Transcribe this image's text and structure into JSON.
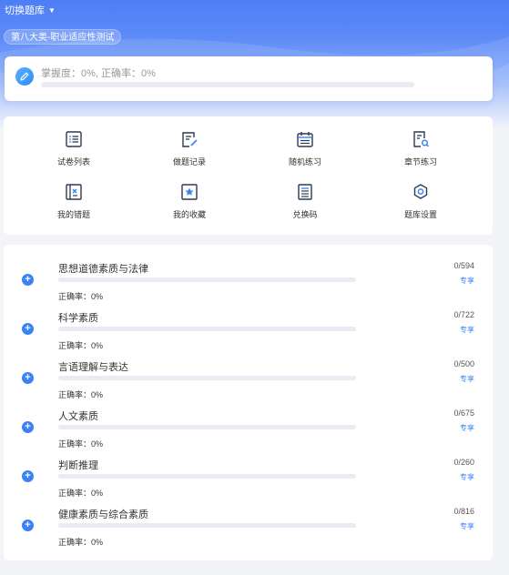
{
  "header": {
    "switch_label": "切换题库",
    "bank_name": "第八大类-职业适应性测试"
  },
  "progress": {
    "text": "掌握度：0%, 正确率：0%",
    "mastery_fraction": 0
  },
  "menu": [
    {
      "label": "试卷列表",
      "icon": "list-icon"
    },
    {
      "label": "做题记录",
      "icon": "edit-record-icon"
    },
    {
      "label": "随机练习",
      "icon": "calendar-icon"
    },
    {
      "label": "章节练习",
      "icon": "document-search-icon"
    },
    {
      "label": "我的错题",
      "icon": "wrong-book-icon"
    },
    {
      "label": "我的收藏",
      "icon": "star-icon"
    },
    {
      "label": "兑换码",
      "icon": "code-list-icon"
    },
    {
      "label": "题库设置",
      "icon": "settings-icon"
    }
  ],
  "chapters": [
    {
      "name": "思想道德素质与法律",
      "count": "0/594",
      "tag": "专享",
      "rate": "正确率：0%",
      "progress": 0
    },
    {
      "name": "科学素质",
      "count": "0/722",
      "tag": "专享",
      "rate": "正确率：0%",
      "progress": 0
    },
    {
      "name": "言语理解与表达",
      "count": "0/500",
      "tag": "专享",
      "rate": "正确率：0%",
      "progress": 0
    },
    {
      "name": "人文素质",
      "count": "0/675",
      "tag": "专享",
      "rate": "正确率：0%",
      "progress": 0
    },
    {
      "name": "判断推理",
      "count": "0/260",
      "tag": "专享",
      "rate": "正确率：0%",
      "progress": 0
    },
    {
      "name": "健康素质与综合素质",
      "count": "0/816",
      "tag": "专享",
      "rate": "正确率：0%",
      "progress": 0
    }
  ],
  "colors": {
    "accent": "#3a82f5",
    "header_blue": "#4d7ef6",
    "track": "#e9ecf3"
  }
}
